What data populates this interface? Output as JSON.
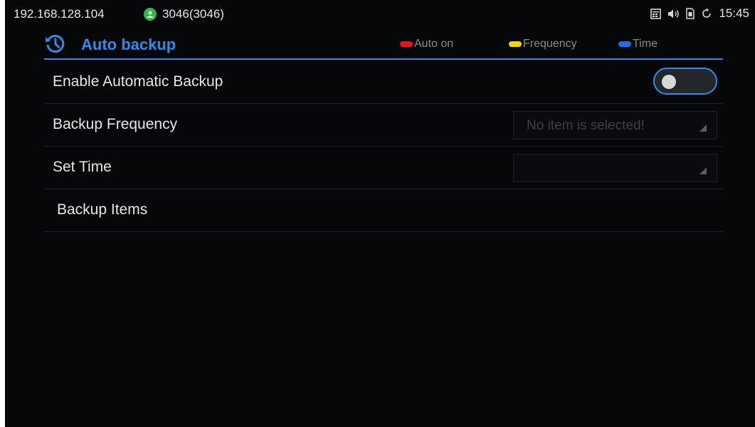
{
  "status_bar": {
    "ip": "192.168.128.104",
    "account": "3046(3046)",
    "account_icon": "account-icon",
    "right_icons": [
      "calendar-icon",
      "speaker-icon",
      "sim-icon",
      "sync-icon"
    ],
    "time": "15:45"
  },
  "header": {
    "title": "Auto backup",
    "icon": "history-icon",
    "legend": [
      {
        "label": "Auto on",
        "color": "#e8131c"
      },
      {
        "label": "Frequency",
        "color": "#f3d31a"
      },
      {
        "label": "Time",
        "color": "#1e6fe3"
      }
    ]
  },
  "settings": {
    "enable_backup": {
      "label": "Enable Automatic Backup",
      "enabled": false
    },
    "frequency": {
      "label": "Backup Frequency",
      "value": "No item is selected!"
    },
    "time": {
      "label": "Set Time",
      "value": ""
    },
    "items": {
      "label": "Backup Items"
    }
  },
  "colors": {
    "accent": "#2e8de6",
    "background": "#060708"
  }
}
